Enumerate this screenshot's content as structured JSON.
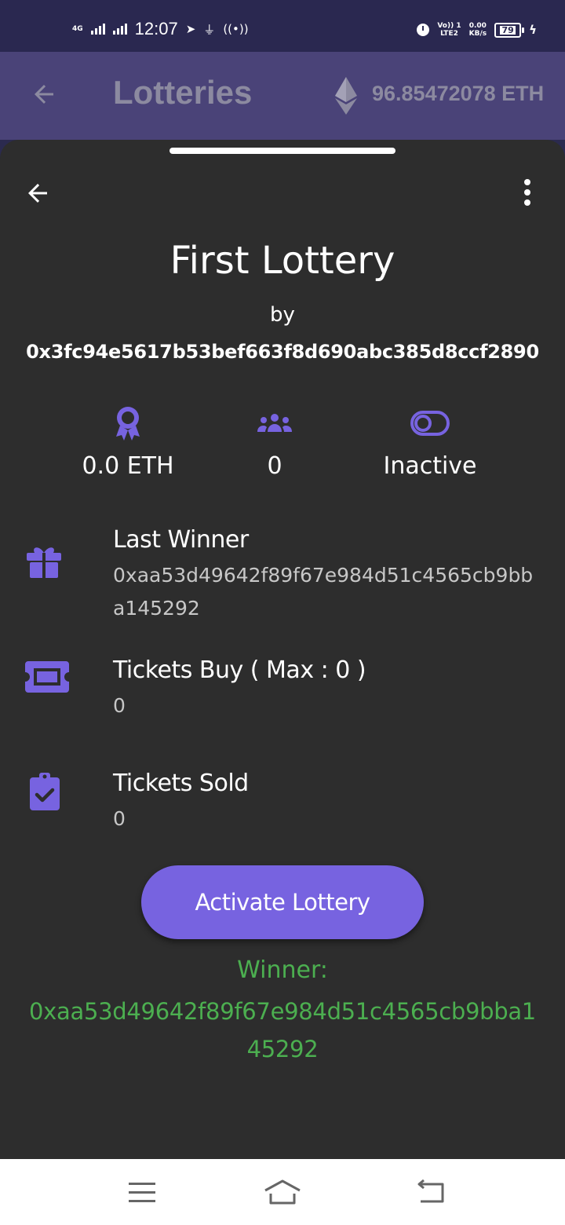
{
  "status_bar": {
    "network": "4G",
    "time": "12:07",
    "volte_label": "Vo)) 1",
    "lte_label": "LTE2",
    "speed_value": "0.00",
    "speed_unit": "KB/s",
    "battery": "79"
  },
  "app_bar": {
    "title": "Lotteries",
    "balance": "96.85472078 ETH",
    "icons": [
      "back-arrow-icon",
      "ethereum-icon"
    ]
  },
  "lottery": {
    "title": "First Lottery",
    "by_label": "by",
    "creator": "0x3fc94e5617b53bef663f8d690abc385d8ccf2890",
    "stats": {
      "prize": "0.0 ETH",
      "participants": "0",
      "status": "Inactive"
    },
    "last_winner": {
      "label": "Last Winner",
      "value": "0xaa53d49642f89f67e984d51c4565cb9bba145292"
    },
    "tickets_buy": {
      "label": "Tickets Buy ( Max : 0 )",
      "value": "0"
    },
    "tickets_sold": {
      "label": "Tickets Sold",
      "value": "0"
    },
    "action_button": "Activate Lottery",
    "winner_label": "Winner:",
    "winner_address": "0xaa53d49642f89f67e984d51c4565cb9bba145292"
  },
  "colors": {
    "accent": "#7763e0",
    "winner": "#4caf50",
    "sheet_bg": "#2d2d2d",
    "app_bar_bg": "#4a4378"
  }
}
